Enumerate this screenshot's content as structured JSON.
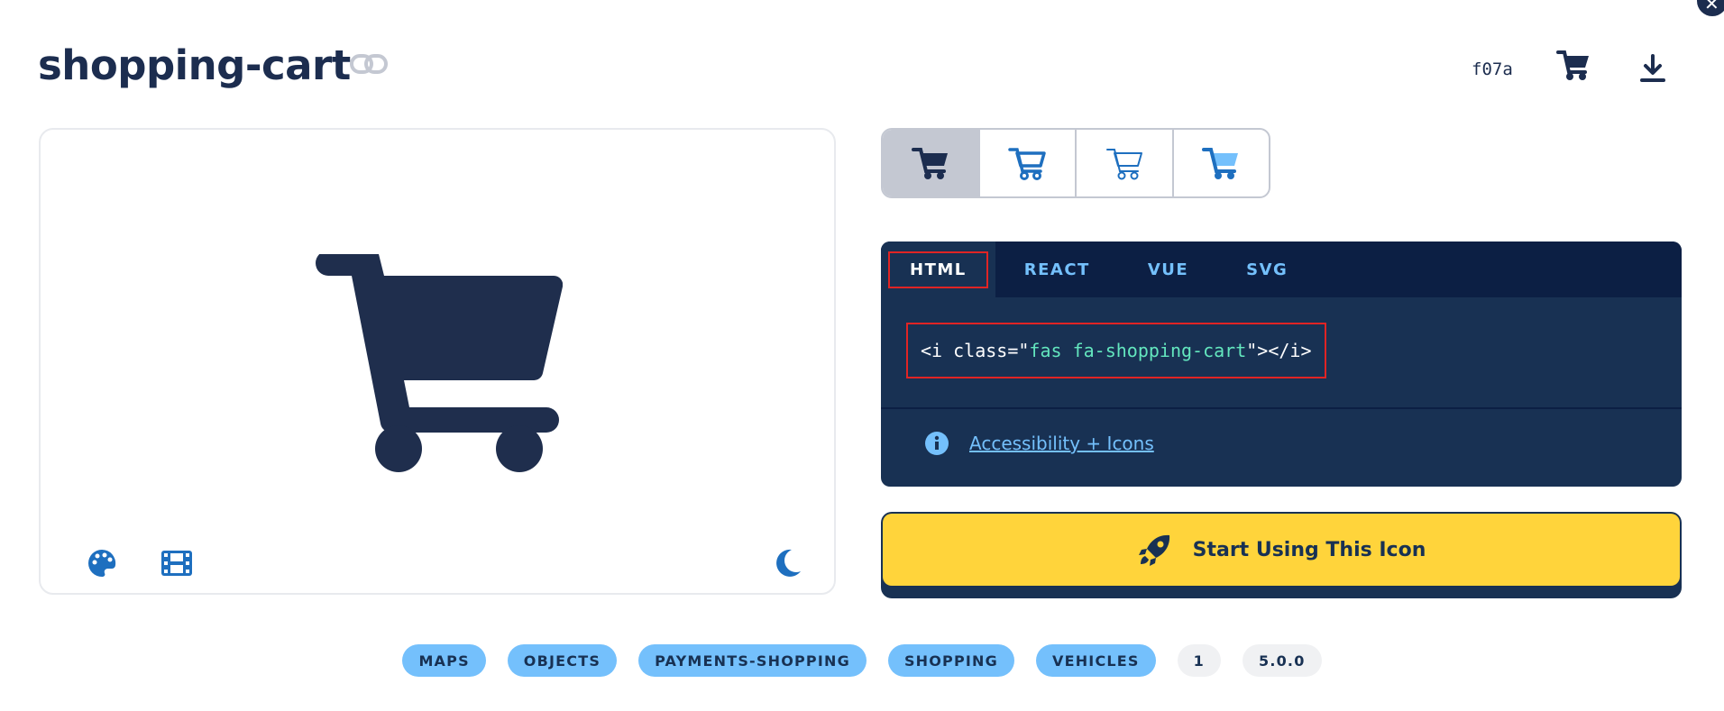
{
  "icon": {
    "name": "shopping-cart",
    "unicode": "f07a"
  },
  "style_tabs": [
    "solid",
    "regular",
    "light",
    "duotone"
  ],
  "code": {
    "tabs": [
      "HTML",
      "REACT",
      "VUE",
      "SVG"
    ],
    "active_tab": "HTML",
    "snippet_prefix": "<i class=\"",
    "snippet_class": "fas fa-shopping-cart",
    "snippet_suffix": "\"></i>",
    "info_link": "Accessibility + Icons"
  },
  "cta": {
    "label": "Start Using This Icon"
  },
  "tags": [
    "MAPS",
    "OBJECTS",
    "PAYMENTS-SHOPPING",
    "SHOPPING",
    "VEHICLES"
  ],
  "meta": {
    "count": "1",
    "version": "5.0.0"
  },
  "colors": {
    "navy": "#183153",
    "dark_navy": "#0c1f44",
    "accent_blue": "#74c0fc",
    "icon_blue": "#1e6fbf",
    "yellow": "#ffd43b",
    "highlight_red": "#e02424"
  }
}
